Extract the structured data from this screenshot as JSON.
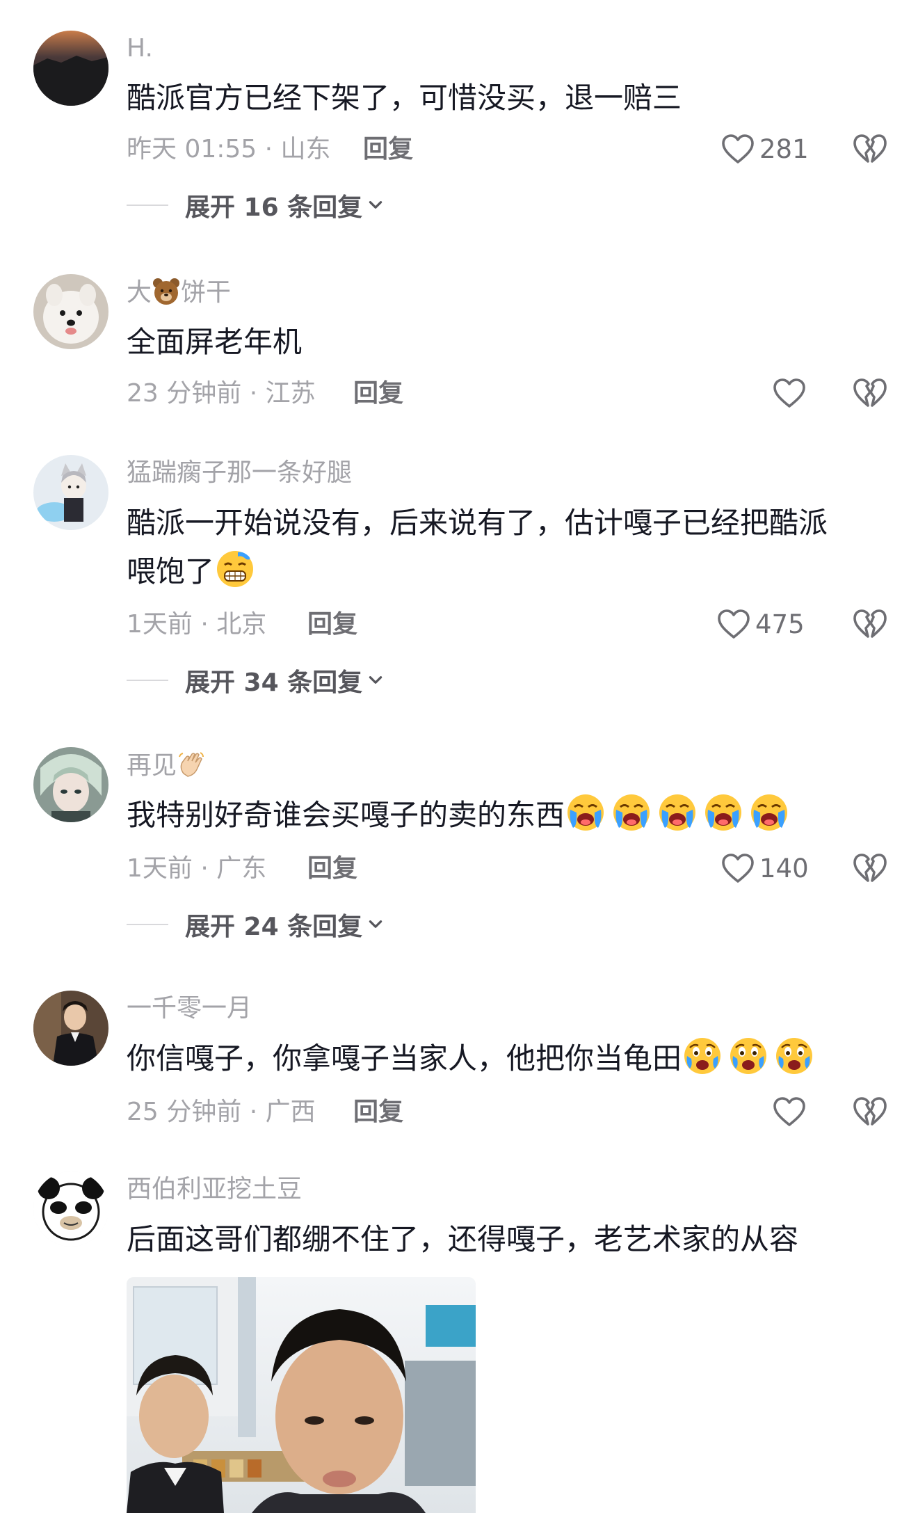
{
  "comments": [
    {
      "username": "H.",
      "text": "酷派官方已经下架了，可惜没买，退一赔三",
      "time": "昨天 01:55",
      "location": "山东",
      "reply_label": "回复",
      "likes": "281",
      "expand_label": "展开 16 条回复"
    },
    {
      "username": "大",
      "username_suffix": "饼干",
      "text": "全面屏老年机",
      "time": "23 分钟前",
      "location": "江苏",
      "reply_label": "回复",
      "likes": ""
    },
    {
      "username": "猛踹瘸子那一条好腿",
      "text_line1": "酷派一开始说没有，后来说有了，估计嘎子已经把酷派",
      "text_line2": "喂饱了",
      "time": "1天前",
      "location": "北京",
      "reply_label": "回复",
      "likes": "475",
      "expand_label": "展开 34 条回复"
    },
    {
      "username": "再见",
      "text": "我特别好奇谁会买嘎子的卖的东西",
      "time": "1天前",
      "location": "广东",
      "reply_label": "回复",
      "likes": "140",
      "expand_label": "展开 24 条回复"
    },
    {
      "username": "一千零一月",
      "text": "你信嘎子，你拿嘎子当家人，他把你当龟田",
      "time": "25 分钟前",
      "location": "广西",
      "reply_label": "回复",
      "likes": ""
    },
    {
      "username": "西伯利亚挖土豆",
      "text": "后面这哥们都绷不住了，还得嘎子，老艺术家的从容"
    }
  ],
  "separator": " · ",
  "icons": {
    "like": "heart-outline-icon",
    "dislike": "broken-heart-icon",
    "expand": "chevron-down-icon"
  },
  "colors": {
    "text_primary": "#161823",
    "text_secondary": "#a3a3a8",
    "text_action": "#6e6e73"
  }
}
